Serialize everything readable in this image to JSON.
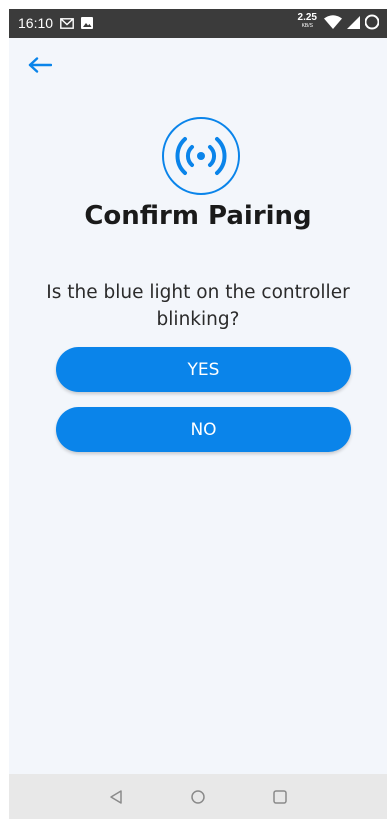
{
  "status_bar": {
    "time": "16:10",
    "net_speed_value": "2.25",
    "net_speed_unit": "KB/S",
    "icons": [
      "gmail-icon",
      "image-icon",
      "wifi-icon",
      "signal-icon",
      "battery-icon"
    ]
  },
  "header": {
    "back_icon": "arrow-left-icon"
  },
  "main": {
    "icon": "broadcast-signal-icon",
    "title": "Confirm Pairing",
    "question": "Is the blue light on the controller blinking?",
    "yes_label": "YES",
    "no_label": "NO"
  },
  "nav_bar": {
    "icons": [
      "back-triangle-icon",
      "home-circle-icon",
      "recents-square-icon"
    ]
  },
  "colors": {
    "accent": "#0a84ea",
    "background": "#f3f6fb",
    "status_bar": "#3b3b3b",
    "nav_bar": "#e8e8e8"
  }
}
